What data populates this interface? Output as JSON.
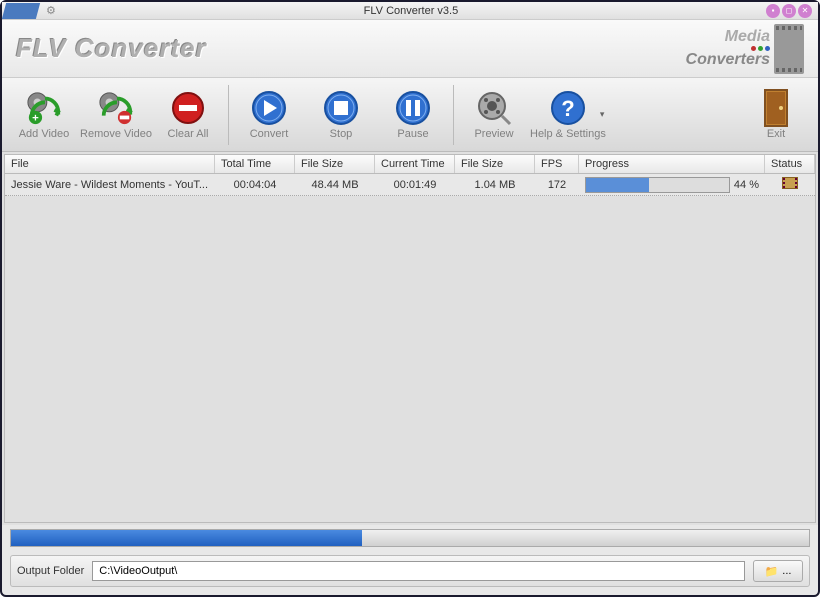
{
  "window": {
    "title": "FLV Converter v3.5"
  },
  "logo": {
    "text": "FLV Converter",
    "brand1": "Media",
    "brand2": "Converters"
  },
  "toolbar": {
    "add": "Add Video",
    "remove": "Remove Video",
    "clear": "Clear All",
    "convert": "Convert",
    "stop": "Stop",
    "pause": "Pause",
    "preview": "Preview",
    "help": "Help & Settings",
    "exit": "Exit"
  },
  "table": {
    "headers": {
      "file": "File",
      "total_time": "Total Time",
      "file_size": "File Size",
      "current_time": "Current Time",
      "file_size2": "File Size",
      "fps": "FPS",
      "progress": "Progress",
      "status": "Status"
    },
    "rows": [
      {
        "file": "Jessie Ware - Wildest Moments - YouT...",
        "total_time": "00:04:04",
        "file_size": "48.44 MB",
        "current_time": "00:01:49",
        "file_size2": "1.04 MB",
        "fps": "172",
        "progress_pct": 44,
        "progress_label": "44 %"
      }
    ]
  },
  "bottom_progress_pct": 44,
  "output": {
    "label": "Output Folder",
    "path": "C:\\VideoOutput\\",
    "browse": "..."
  }
}
